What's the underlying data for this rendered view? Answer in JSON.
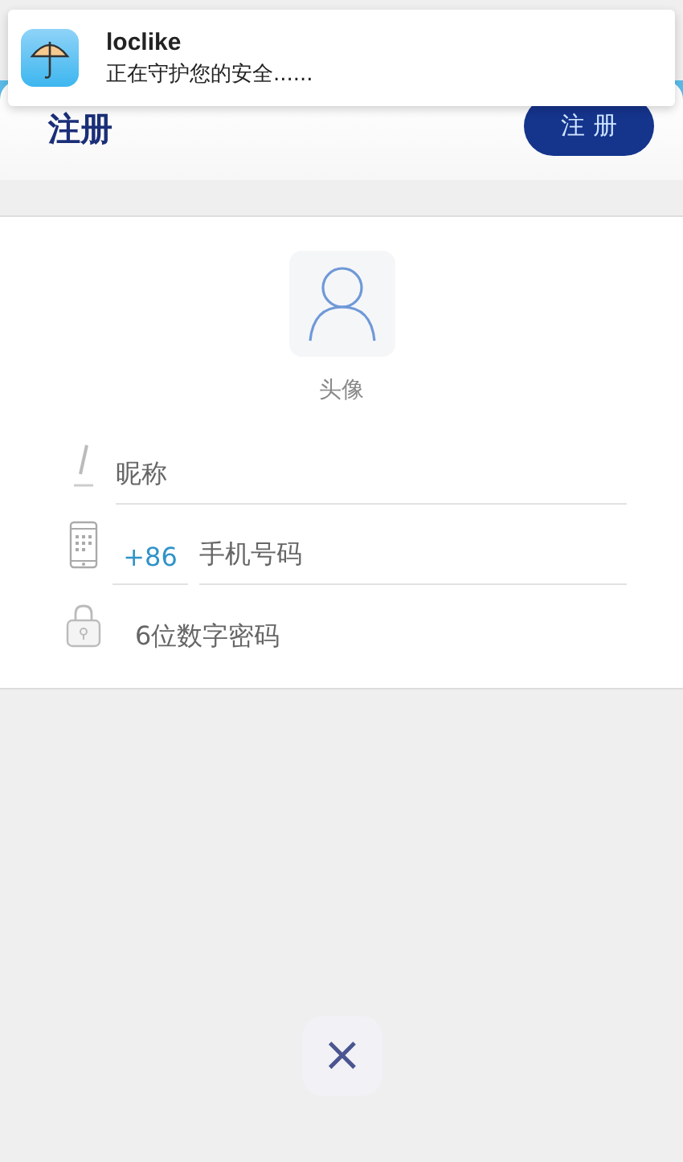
{
  "notification": {
    "app_name": "loclike",
    "message": "正在守护您的安全......"
  },
  "header": {
    "title": "注册",
    "button": "注 册"
  },
  "avatar": {
    "label": "头像"
  },
  "fields": [
    {
      "kind": "nickname",
      "placeholder": "昵称"
    },
    {
      "kind": "phone",
      "prefix": "+86",
      "placeholder": "手机号码"
    },
    {
      "kind": "password",
      "placeholder": "6位数字密码"
    }
  ],
  "close_button": "×"
}
